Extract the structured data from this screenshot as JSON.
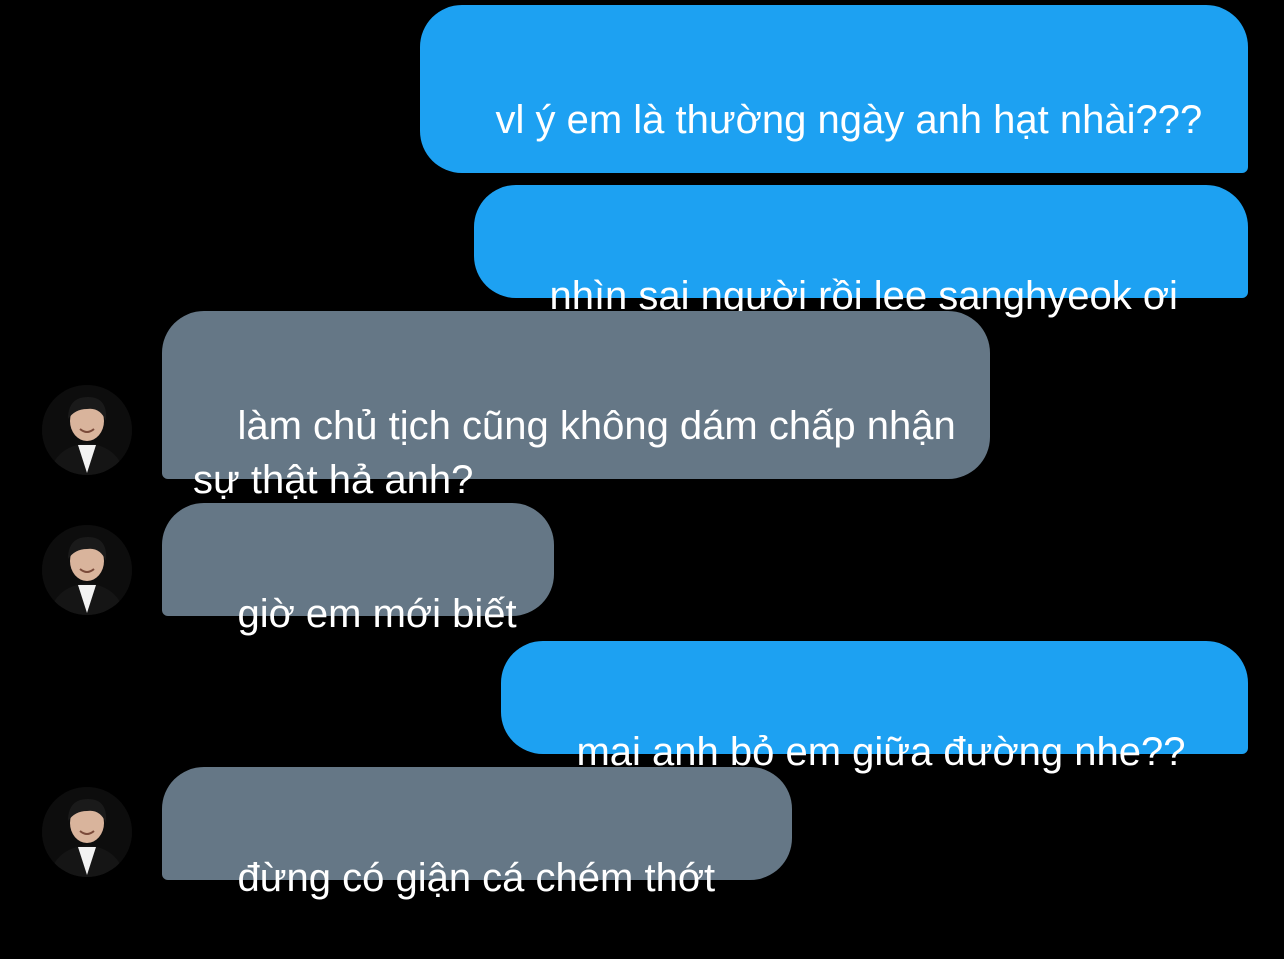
{
  "conversation": {
    "messages": [
      {
        "sender": "me",
        "text": "vl ý em là thường ngày anh hạt nhài???"
      },
      {
        "sender": "me",
        "text": "nhìn sai người rồi lee sanghyeok ơi"
      },
      {
        "sender": "other",
        "text": "làm chủ tịch cũng không dám chấp nhận sự thật hả anh?"
      },
      {
        "sender": "other",
        "text": "giờ em mới biết"
      },
      {
        "sender": "me",
        "text": "mai anh bỏ em giữa đường nhe??"
      },
      {
        "sender": "other",
        "text": "đừng có giận cá chém thớt"
      }
    ]
  },
  "colors": {
    "background": "#000000",
    "sent_bubble": "#1da1f2",
    "received_bubble": "#657786",
    "bubble_text": "#ffffff"
  },
  "icons": {
    "avatar": "contact-avatar-photo"
  }
}
